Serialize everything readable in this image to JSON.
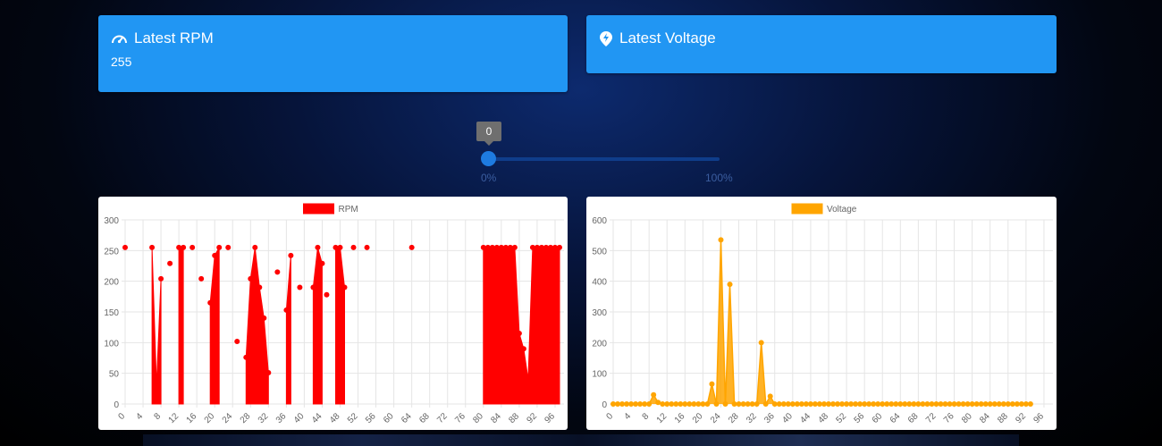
{
  "cards": {
    "rpm": {
      "title": "Latest RPM",
      "value": "255",
      "icon": "speedometer-icon"
    },
    "voltage": {
      "title": "Latest Voltage",
      "value": "",
      "icon": "voltage-icon"
    }
  },
  "slider": {
    "value": "0",
    "min_label": "0%",
    "max_label": "100%",
    "fraction": 0
  },
  "colors": {
    "card": "#2196f3",
    "rpm": "#ff0000",
    "voltage": "#ffa500"
  },
  "chart_data": [
    {
      "type": "area",
      "legend": [
        "RPM"
      ],
      "series": [
        {
          "name": "RPM",
          "color": "#ff0000"
        }
      ],
      "x_ticks": [
        "0",
        "4",
        "8",
        "12",
        "16",
        "20",
        "24",
        "28",
        "32",
        "36",
        "40",
        "44",
        "48",
        "52",
        "56",
        "60",
        "64",
        "68",
        "72",
        "76",
        "80",
        "84",
        "88",
        "92",
        "96"
      ],
      "ylim": [
        0,
        300
      ],
      "y_ticks": [
        "0",
        "50",
        "100",
        "150",
        "200",
        "250",
        "300"
      ],
      "grid": true,
      "x": [
        0,
        6,
        7,
        8,
        10,
        12,
        13,
        15,
        17,
        19,
        20,
        21,
        23,
        25,
        27,
        28,
        29,
        30,
        31,
        32,
        34,
        36,
        37,
        39,
        42,
        43,
        44,
        45,
        47,
        48,
        49,
        51,
        54,
        64,
        80,
        81,
        82,
        83,
        84,
        85,
        86,
        87,
        88,
        89,
        90,
        91,
        92,
        93,
        94,
        95,
        96,
        97
      ],
      "y": [
        255,
        255,
        30,
        204,
        229,
        255,
        255,
        255,
        204,
        165,
        242,
        255,
        255,
        102,
        76,
        204,
        255,
        190,
        140,
        51,
        215,
        153,
        242,
        190,
        190,
        255,
        229,
        178,
        255,
        255,
        190,
        255,
        255,
        255,
        255,
        255,
        255,
        255,
        255,
        255,
        255,
        255,
        115,
        90,
        40,
        255,
        255,
        255,
        255,
        255,
        255,
        255
      ],
      "filled_ranges": [
        [
          6,
          8
        ],
        [
          12,
          13
        ],
        [
          19,
          21
        ],
        [
          27,
          32
        ],
        [
          36,
          37
        ],
        [
          42,
          44
        ],
        [
          46,
          49
        ],
        [
          80,
          97
        ]
      ]
    },
    {
      "type": "line",
      "legend": [
        "Voltage"
      ],
      "series": [
        {
          "name": "Voltage",
          "color": "#ffa500"
        }
      ],
      "x_ticks": [
        "0",
        "4",
        "8",
        "12",
        "16",
        "20",
        "24",
        "28",
        "32",
        "36",
        "40",
        "44",
        "48",
        "52",
        "56",
        "60",
        "64",
        "68",
        "72",
        "76",
        "80",
        "84",
        "88",
        "92",
        "96"
      ],
      "ylim": [
        0,
        600
      ],
      "y_ticks": [
        "0",
        "100",
        "200",
        "300",
        "400",
        "500",
        "600"
      ],
      "grid": true,
      "x_count": 94,
      "peaks": {
        "9": 30,
        "10": 5,
        "22": 65,
        "24": 535,
        "26": 390,
        "33": 200,
        "35": 25
      }
    }
  ]
}
